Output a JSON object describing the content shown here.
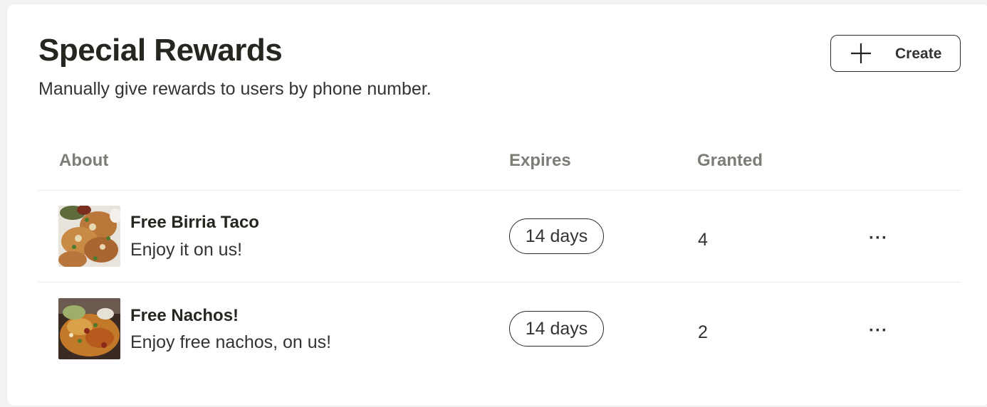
{
  "header": {
    "title": "Special Rewards",
    "subtitle": "Manually give rewards to users by phone number.",
    "create_label": "Create"
  },
  "table": {
    "columns": [
      "About",
      "Expires",
      "Granted"
    ],
    "rows": [
      {
        "name": "Free Birria Taco",
        "description": "Enjoy it on us!",
        "expires": "14 days",
        "granted": "4",
        "more": "···",
        "thumbnail": "tacos-photo"
      },
      {
        "name": "Free Nachos!",
        "description": "Enjoy free nachos, on us!",
        "expires": "14 days",
        "granted": "2",
        "more": "···",
        "thumbnail": "nachos-photo"
      }
    ]
  }
}
